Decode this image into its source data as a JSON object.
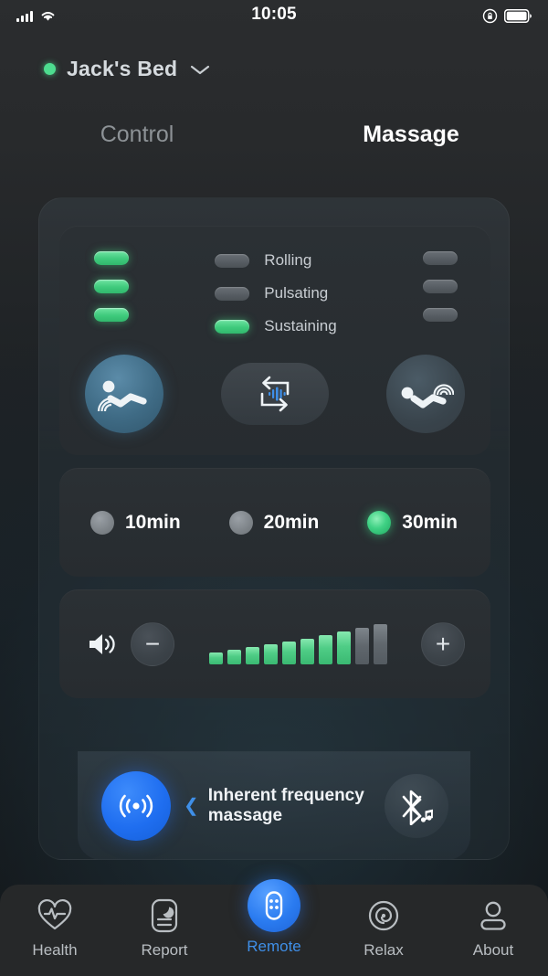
{
  "status_bar": {
    "time": "10:05",
    "signal_icon": "cellular-bars-icon",
    "wifi_icon": "wifi-icon",
    "rotation_lock_icon": "rotation-lock-icon",
    "battery_icon": "battery-icon"
  },
  "device": {
    "name": "Jack's Bed",
    "connected": true,
    "status_dot_color": "#4ddc8f",
    "dropdown_icon": "chevron-down-icon"
  },
  "tabs": [
    {
      "label": "Control",
      "active": false
    },
    {
      "label": "Massage",
      "active": true
    }
  ],
  "massage_modes": {
    "left_indicators": [
      {
        "state": "on"
      },
      {
        "state": "on"
      },
      {
        "state": "on"
      }
    ],
    "modes": [
      {
        "label": "Rolling",
        "state": "off"
      },
      {
        "label": "Pulsating",
        "state": "off"
      },
      {
        "label": "Sustaining",
        "state": "on"
      }
    ],
    "right_indicators": [
      {
        "state": "off"
      },
      {
        "state": "off"
      },
      {
        "state": "off"
      }
    ],
    "zone_buttons": [
      {
        "icon": "head-massage-icon",
        "active": true
      },
      {
        "icon": "sync-wave-loop-icon",
        "active": false
      },
      {
        "icon": "foot-massage-icon",
        "active": false
      }
    ]
  },
  "timer": {
    "options": [
      {
        "label": "10min",
        "selected": false
      },
      {
        "label": "20min",
        "selected": false
      },
      {
        "label": "30min",
        "selected": true
      }
    ]
  },
  "intensity": {
    "speaker_icon": "volume-icon",
    "minus_label": "−",
    "plus_label": "+",
    "level": 8,
    "max": 10,
    "bars": [
      {
        "filled": true
      },
      {
        "filled": true
      },
      {
        "filled": true
      },
      {
        "filled": true
      },
      {
        "filled": true
      },
      {
        "filled": true
      },
      {
        "filled": true
      },
      {
        "filled": true
      },
      {
        "filled": false
      },
      {
        "filled": false
      }
    ]
  },
  "frequency": {
    "broadcast_icon": "broadcast-wave-icon",
    "chevron": "❮",
    "label": "Inherent frequency massage",
    "bluetooth_icon": "bluetooth-music-icon"
  },
  "bottom_nav": [
    {
      "label": "Health",
      "icon": "heart-pulse-icon",
      "active": false
    },
    {
      "label": "Report",
      "icon": "sleep-report-icon",
      "active": false
    },
    {
      "label": "Remote",
      "icon": "remote-control-icon",
      "active": true
    },
    {
      "label": "Relax",
      "icon": "spiral-target-icon",
      "active": false
    },
    {
      "label": "About",
      "icon": "person-icon",
      "active": false
    }
  ],
  "colors": {
    "accent_blue": "#2a7bf0",
    "accent_green": "#4fcd86",
    "panel_bg": "#2b3034",
    "text_primary": "#ffffff",
    "text_secondary": "#8d9296"
  }
}
